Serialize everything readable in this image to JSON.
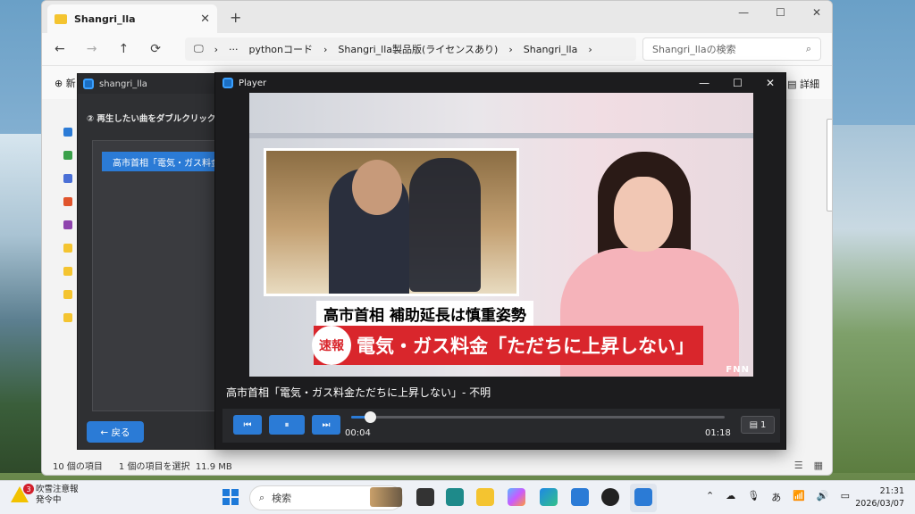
{
  "explorer": {
    "tab_title": "Shangri_lla",
    "new_tab": "+",
    "breadcrumbs": [
      "pythonコード",
      "Shangri_lla製品版(ライセンスあり)",
      "Shangri_lla"
    ],
    "search_placeholder": "Shangri_llaの検索",
    "command_new_prefix": "新",
    "command_details": "詳細",
    "status_item_count": "10 個の項目",
    "status_selection": "1 個の項目を選択",
    "status_size": "11.9 MB"
  },
  "shangri_app": {
    "title": "shangri_lla",
    "step_instruction": "② 再生したい曲をダブルクリック",
    "list_items": [
      "高市首相「電気・ガス料金ただちに上昇しない」- 不明"
    ],
    "back_label": "← 戻る"
  },
  "player": {
    "title": "Player",
    "video_headline": "高市首相 補助延長は慎重姿勢",
    "video_breaking_badge": "速報",
    "video_breaking_text": "電気・ガス料金「ただちに上昇しない」",
    "video_broadcaster": "FNN",
    "now_playing": "高市首相「電気・ガス料金ただちに上昇しない」- 不明",
    "current_time": "00:04",
    "total_time": "01:18",
    "progress_fraction": 0.05,
    "playlist_count": "1",
    "accent_color": "#2b7bd6"
  },
  "taskbar": {
    "alert_count": "3",
    "alert_title": "吹雪注意報",
    "alert_status": "発令中",
    "search_label": "検索",
    "ime_mode": "あ",
    "time": "21:31",
    "date": "2026/03/07"
  }
}
